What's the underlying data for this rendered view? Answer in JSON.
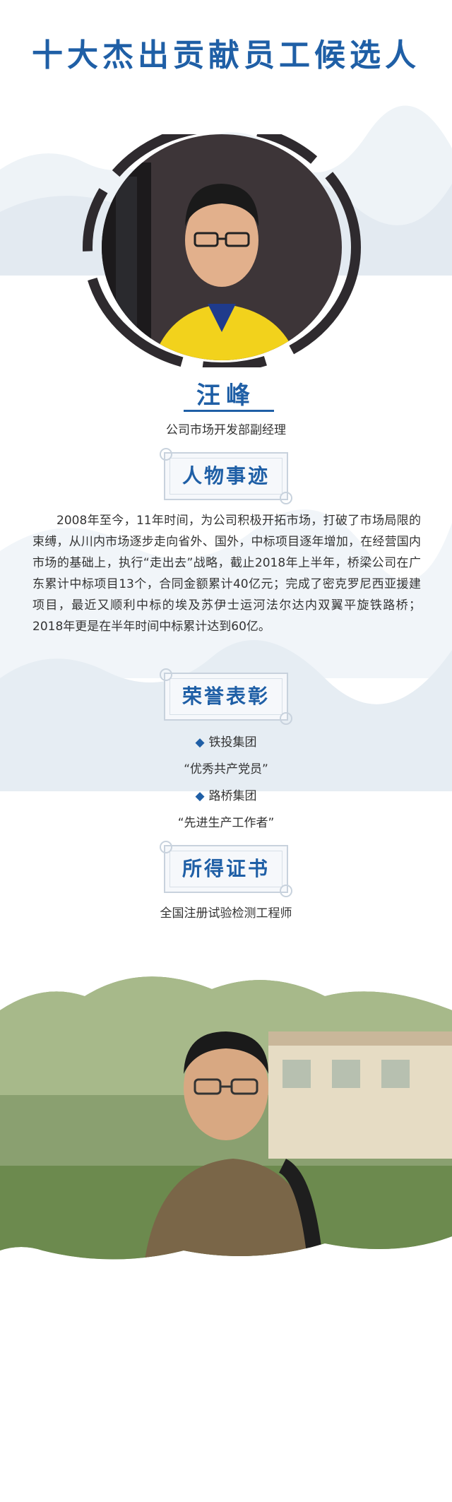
{
  "page": {
    "title": "十大杰出贡献员工候选人",
    "name": "汪峰",
    "position": "公司市场开发部副经理"
  },
  "sections": {
    "story": {
      "heading": "人物事迹",
      "text": "2008年至今，11年时间，为公司积极开拓市场，打破了市场局限的束缚，从川内市场逐步走向省外、国外，中标项目逐年增加，在经营国内市场的基础上，执行“走出去”战略，截止2018年上半年，桥梁公司在广东累计中标项目13个，合同金额累计40亿元；完成了密克罗尼西亚援建项目，最近又顺利中标的埃及苏伊士运河法尔达内双翼平旋铁路桥；2018年更是在半年时间中标累计达到60亿。"
    },
    "honors": {
      "heading": "荣誉表彰",
      "items": [
        {
          "org": "铁投集团",
          "award": "“优秀共产党员”"
        },
        {
          "org": "路桥集团",
          "award": "“先进生产工作者”"
        }
      ]
    },
    "certificate": {
      "heading": "所得证书",
      "text": "全国注册试验检测工程师"
    }
  },
  "colors": {
    "accent": "#1f5fa6",
    "mist": "#dfe7ef"
  }
}
